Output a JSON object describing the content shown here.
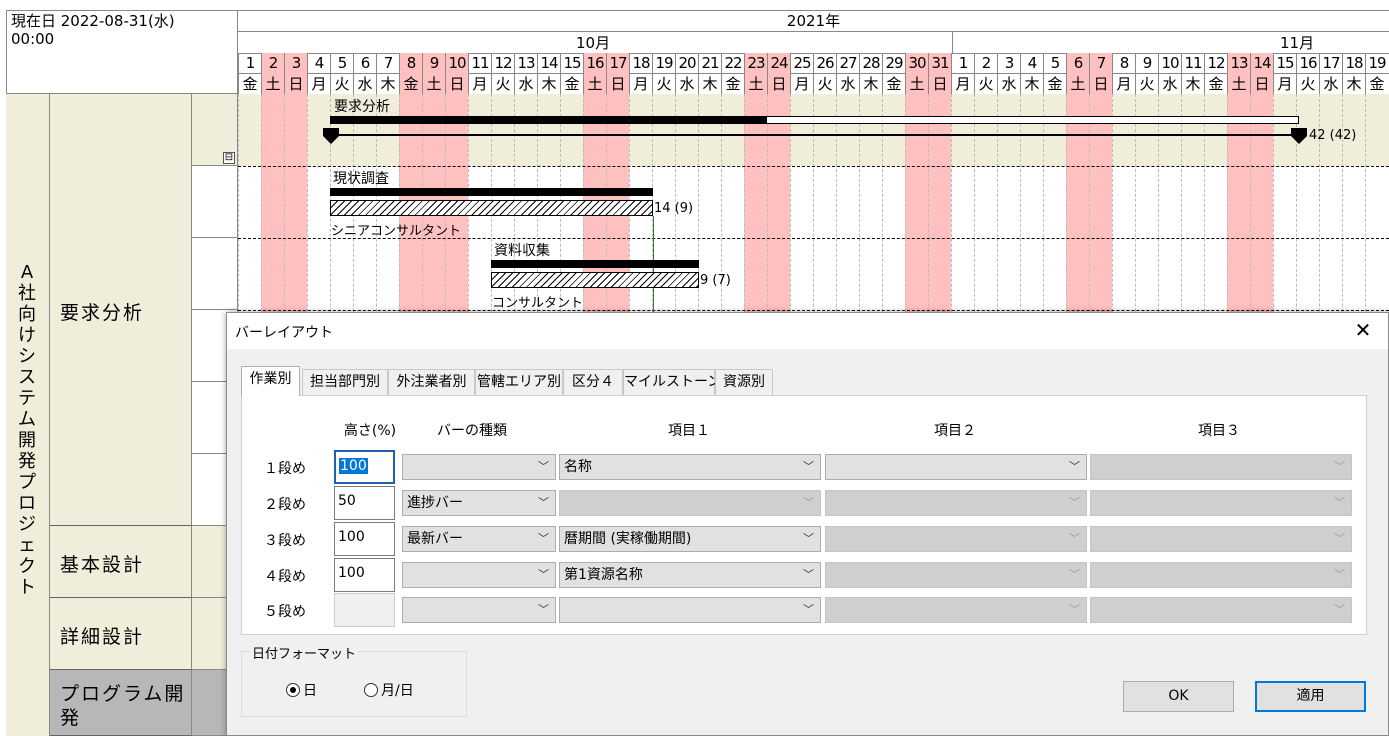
{
  "header": {
    "current_date_label": "現在日 2022-08-31(水)\n00:00",
    "year": "2021年",
    "month_oct": "10月",
    "month_nov": "11月"
  },
  "calendar": {
    "days": [
      {
        "d": "1",
        "w": "金",
        "off": false
      },
      {
        "d": "2",
        "w": "土",
        "off": true
      },
      {
        "d": "3",
        "w": "日",
        "off": true
      },
      {
        "d": "4",
        "w": "月",
        "off": false
      },
      {
        "d": "5",
        "w": "火",
        "off": false
      },
      {
        "d": "6",
        "w": "水",
        "off": false
      },
      {
        "d": "7",
        "w": "木",
        "off": false
      },
      {
        "d": "8",
        "w": "金",
        "off": true
      },
      {
        "d": "9",
        "w": "土",
        "off": true
      },
      {
        "d": "10",
        "w": "日",
        "off": true
      },
      {
        "d": "11",
        "w": "月",
        "off": false
      },
      {
        "d": "12",
        "w": "火",
        "off": false
      },
      {
        "d": "13",
        "w": "水",
        "off": false
      },
      {
        "d": "14",
        "w": "木",
        "off": false
      },
      {
        "d": "15",
        "w": "金",
        "off": false
      },
      {
        "d": "16",
        "w": "土",
        "off": true
      },
      {
        "d": "17",
        "w": "日",
        "off": true
      },
      {
        "d": "18",
        "w": "月",
        "off": false
      },
      {
        "d": "19",
        "w": "火",
        "off": false
      },
      {
        "d": "20",
        "w": "水",
        "off": false
      },
      {
        "d": "21",
        "w": "木",
        "off": false
      },
      {
        "d": "22",
        "w": "金",
        "off": false
      },
      {
        "d": "23",
        "w": "土",
        "off": true
      },
      {
        "d": "24",
        "w": "日",
        "off": true
      },
      {
        "d": "25",
        "w": "月",
        "off": false
      },
      {
        "d": "26",
        "w": "火",
        "off": false
      },
      {
        "d": "27",
        "w": "水",
        "off": false
      },
      {
        "d": "28",
        "w": "木",
        "off": false
      },
      {
        "d": "29",
        "w": "金",
        "off": false
      },
      {
        "d": "30",
        "w": "土",
        "off": true
      },
      {
        "d": "31",
        "w": "日",
        "off": true
      },
      {
        "d": "1",
        "w": "月",
        "off": false
      },
      {
        "d": "2",
        "w": "火",
        "off": false
      },
      {
        "d": "3",
        "w": "水",
        "off": false
      },
      {
        "d": "4",
        "w": "木",
        "off": false
      },
      {
        "d": "5",
        "w": "金",
        "off": false
      },
      {
        "d": "6",
        "w": "土",
        "off": true
      },
      {
        "d": "7",
        "w": "日",
        "off": true
      },
      {
        "d": "8",
        "w": "月",
        "off": false
      },
      {
        "d": "9",
        "w": "火",
        "off": false
      },
      {
        "d": "10",
        "w": "水",
        "off": false
      },
      {
        "d": "11",
        "w": "木",
        "off": false
      },
      {
        "d": "12",
        "w": "金",
        "off": false
      },
      {
        "d": "13",
        "w": "土",
        "off": true
      },
      {
        "d": "14",
        "w": "日",
        "off": true
      },
      {
        "d": "15",
        "w": "月",
        "off": false
      },
      {
        "d": "16",
        "w": "火",
        "off": false
      },
      {
        "d": "17",
        "w": "水",
        "off": false
      },
      {
        "d": "18",
        "w": "木",
        "off": false
      },
      {
        "d": "19",
        "w": "金",
        "off": false
      }
    ]
  },
  "tree": {
    "project": "A社向けシステム開発プロジェクト",
    "phases": [
      "要求分析",
      "基本設計",
      "詳細設計",
      "プログラム開発"
    ],
    "collapse_glyph": "⊟"
  },
  "tasks": {
    "summary_label": "要求分析",
    "summary_duration": "42 (42)",
    "task1_label": "現状調査",
    "task1_duration": "14 (9)",
    "task1_resource": "シニアコンサルタント",
    "task2_label": "資料収集",
    "task2_duration": "9 (7)",
    "task2_resource": "コンサルタント"
  },
  "dialog": {
    "title": "バーレイアウト",
    "close_glyph": "✕",
    "tabs": [
      "作業別",
      "担当部門別",
      "外注業者別",
      "管轄エリア別",
      "区分４",
      "マイルストーン",
      "資源別"
    ],
    "columns": {
      "height": "高さ(%)",
      "bar_type": "バーの種類",
      "item1": "項目１",
      "item2": "項目２",
      "item3": "項目３"
    },
    "rows": [
      {
        "label": "１段め",
        "height": "100",
        "bar_type": "",
        "item1": "名称",
        "item2": "",
        "item3": ""
      },
      {
        "label": "２段め",
        "height": "50",
        "bar_type": "進捗バー",
        "item1": "",
        "item2": "",
        "item3": ""
      },
      {
        "label": "３段め",
        "height": "100",
        "bar_type": "最新バー",
        "item1": "暦期間 (実稼働期間)",
        "item2": "",
        "item3": ""
      },
      {
        "label": "４段め",
        "height": "100",
        "bar_type": "",
        "item1": "第1資源名称",
        "item2": "",
        "item3": ""
      },
      {
        "label": "５段め",
        "height": "",
        "bar_type": "",
        "item1": "",
        "item2": "",
        "item3": ""
      }
    ],
    "date_format_group": "日付フォーマット",
    "radio_day": "日",
    "radio_month_day": "月/日",
    "ok_button": "OK",
    "apply_button": "適用",
    "dropdown_glyph": "﹀"
  },
  "colors": {
    "weekend": "#ffc0c0",
    "beige": "#f0eedb",
    "accent": "#0078d7"
  }
}
